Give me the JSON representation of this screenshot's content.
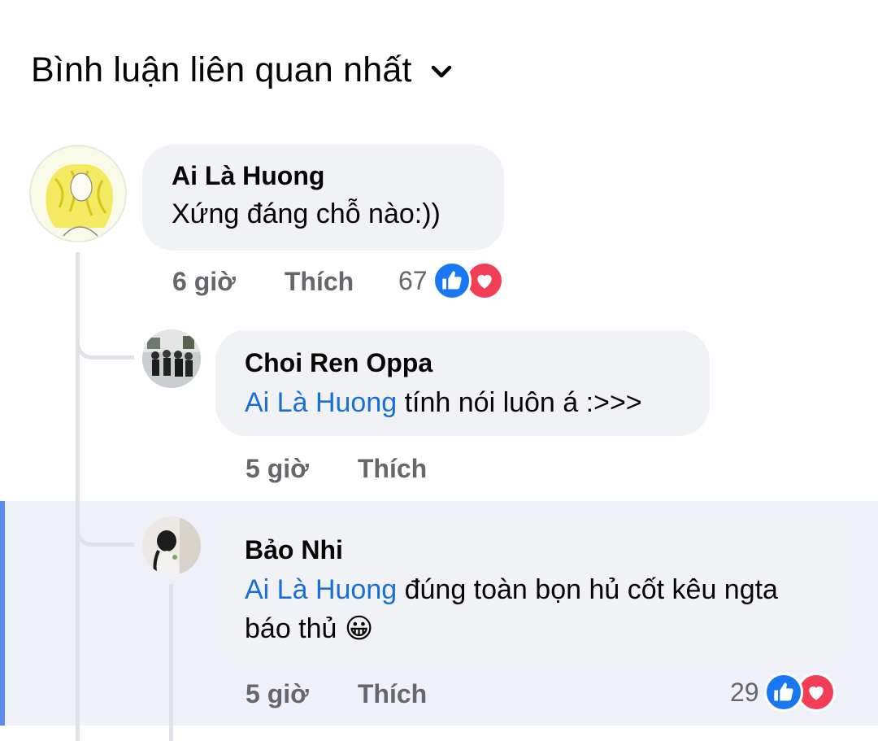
{
  "header": {
    "title": "Bình luận liên quan nhất",
    "chevron_icon": "chevron-down-icon"
  },
  "colors": {
    "mention": "#1a6fd6",
    "like": "#1877f2",
    "love": "#f33e58",
    "highlight_bar": "#5b8def"
  },
  "comments": [
    {
      "author": "Ai Là Huong",
      "text": "Xứng đáng chỗ nào:))",
      "time": "6 giờ",
      "like_label": "Thích",
      "reaction_count": "67",
      "reactions": [
        "like-icon",
        "love-icon"
      ]
    },
    {
      "author": "Choi Ren Oppa",
      "mention": "Ai Là Huong",
      "text": " tính nói luôn á :>>>",
      "time": "5 giờ",
      "like_label": "Thích"
    },
    {
      "author": "Bảo Nhi",
      "mention": "Ai Là Huong",
      "text": " đúng toàn bọn hủ cốt kêu ngta báo thủ",
      "emoji": "😀",
      "time": "5 giờ",
      "like_label": "Thích",
      "reaction_count": "29",
      "reactions": [
        "like-icon",
        "love-icon"
      ]
    }
  ]
}
